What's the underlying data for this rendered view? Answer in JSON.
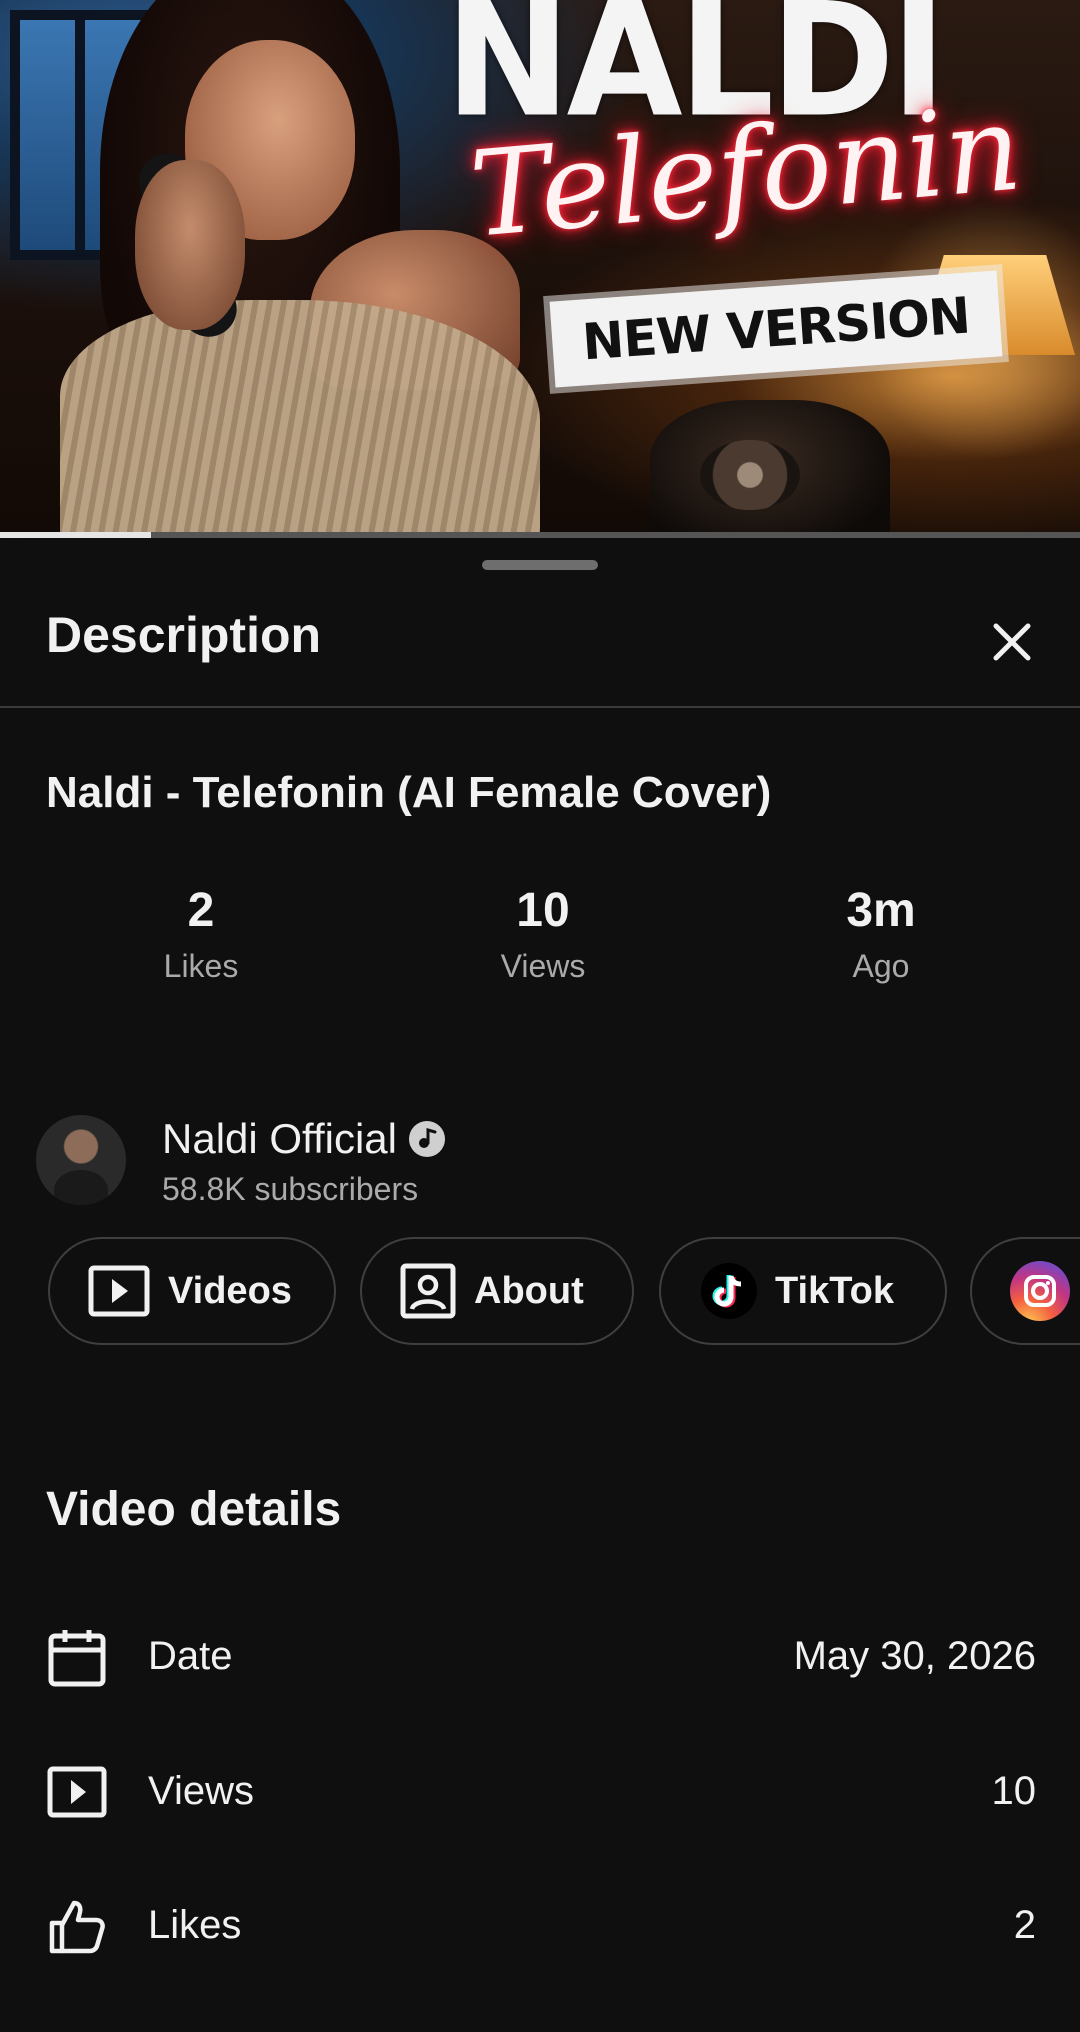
{
  "video": {
    "thumbnail": {
      "title_main": "NALDI",
      "title_script": "Telefonin",
      "badge": "NEW VERSION"
    },
    "progress_fraction": 0.14
  },
  "sheet": {
    "title": "Description",
    "close_icon": "close-icon"
  },
  "description": {
    "video_title": "Naldi - Telefonin (AI Female Cover)",
    "stats": [
      {
        "value": "2",
        "label": "Likes"
      },
      {
        "value": "10",
        "label": "Views"
      },
      {
        "value": "3m",
        "label": "Ago"
      }
    ]
  },
  "channel": {
    "name": "Naldi Official",
    "subscribers": "58.8K subscribers",
    "verified_icon": "verified-music-icon"
  },
  "chips": [
    {
      "label": "Videos",
      "icon": "play-box-icon"
    },
    {
      "label": "About",
      "icon": "profile-card-icon"
    },
    {
      "label": "TikTok",
      "icon": "tiktok-icon"
    },
    {
      "label": "",
      "icon": "instagram-icon"
    }
  ],
  "video_details": {
    "title": "Video details",
    "rows": [
      {
        "label": "Date",
        "value": "May 30, 2026",
        "icon": "calendar-icon"
      },
      {
        "label": "Views",
        "value": "10",
        "icon": "play-box-icon"
      },
      {
        "label": "Likes",
        "value": "2",
        "icon": "thumbs-up-icon"
      }
    ]
  },
  "colors": {
    "background": "#0f0f0f",
    "text_primary": "#f1f1f1",
    "text_secondary": "#aaaaaa",
    "chip_border": "#3f3f3f"
  }
}
